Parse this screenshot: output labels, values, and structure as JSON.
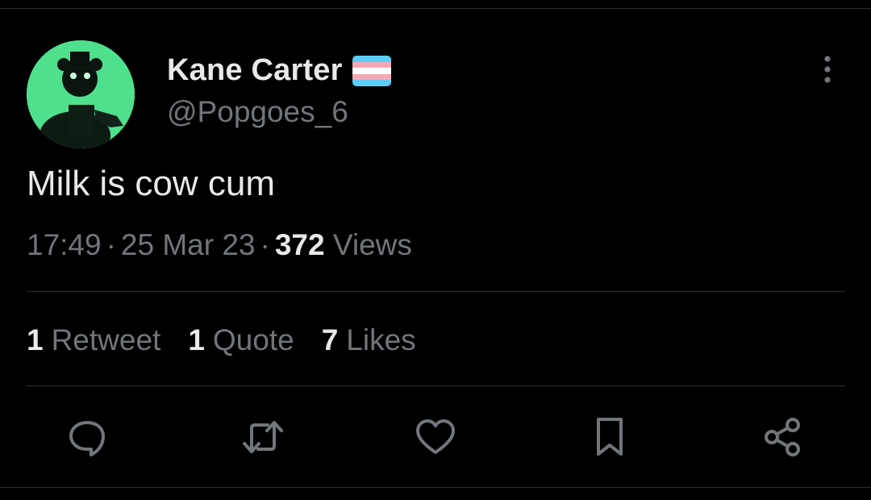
{
  "author": {
    "display_name": "Kane Carter",
    "handle": "@Popgoes_6",
    "flag_icon": "transgender-flag-icon"
  },
  "tweet": {
    "text": "Milk is cow cum",
    "time": "17:49",
    "separator": "·",
    "date": "25 Mar 23",
    "views_count": "372",
    "views_label": "Views"
  },
  "stats": {
    "retweets_count": "1",
    "retweets_label": "Retweet",
    "quotes_count": "1",
    "quotes_label": "Quote",
    "likes_count": "7",
    "likes_label": "Likes"
  },
  "actions": [
    "reply-icon",
    "retweet-icon",
    "like-icon",
    "bookmark-icon",
    "share-icon"
  ],
  "colors": {
    "background": "#000000",
    "primary_text": "#e7e9ea",
    "secondary_text": "#71767b",
    "divider": "#2f3336",
    "avatar_bg": "#4ee08c",
    "flag_blue": "#5bcefa",
    "flag_pink": "#f5a9b8",
    "flag_white": "#ffffff"
  }
}
